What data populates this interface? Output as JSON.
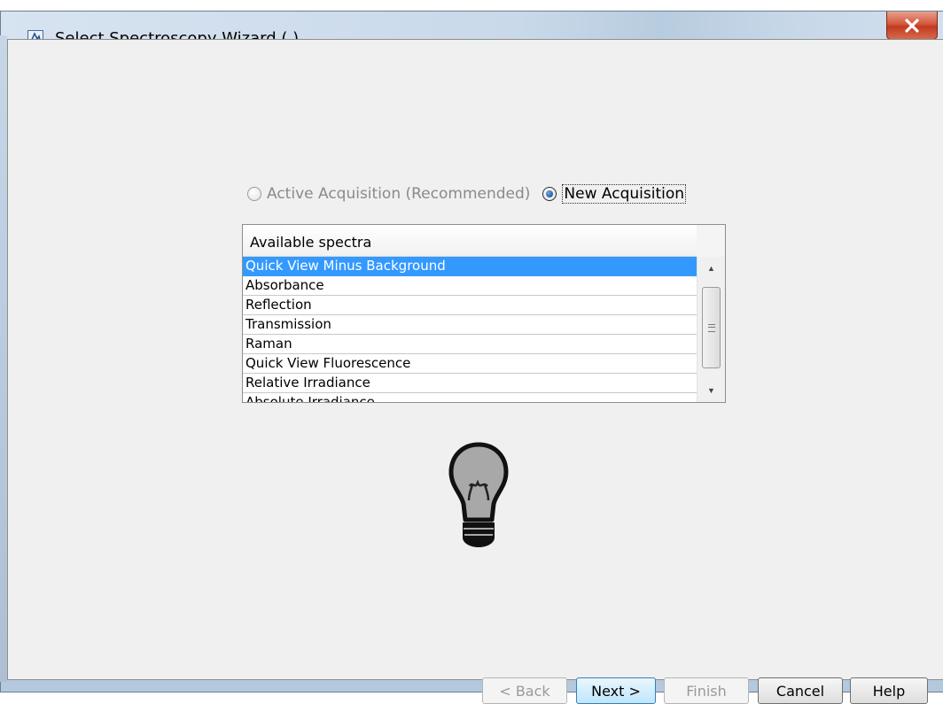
{
  "window": {
    "title": "Select Spectroscopy Wizard ( )",
    "close_label": "X"
  },
  "acquisition": {
    "options": [
      {
        "label": "Active Acquisition (Recommended)",
        "selected": false,
        "enabled": false
      },
      {
        "label": "New Acquisition",
        "selected": true,
        "enabled": true
      }
    ]
  },
  "spectra_list": {
    "header": "Available spectra",
    "items": [
      "Quick View Minus Background",
      "Absorbance",
      "Reflection",
      "Transmission",
      "Raman",
      "Quick View Fluorescence",
      "Relative Irradiance",
      "Absolute Irradiance"
    ],
    "selected_index": 0
  },
  "buttons": {
    "back": "< Back",
    "next": "Next >",
    "finish": "Finish",
    "cancel": "Cancel",
    "help": "Help"
  },
  "colors": {
    "selection": "#3399ff",
    "background": "#f0f0f0",
    "close_button": "#c8432a"
  },
  "icons": {
    "app": "wizard-app-icon",
    "hint": "lightbulb-icon"
  }
}
